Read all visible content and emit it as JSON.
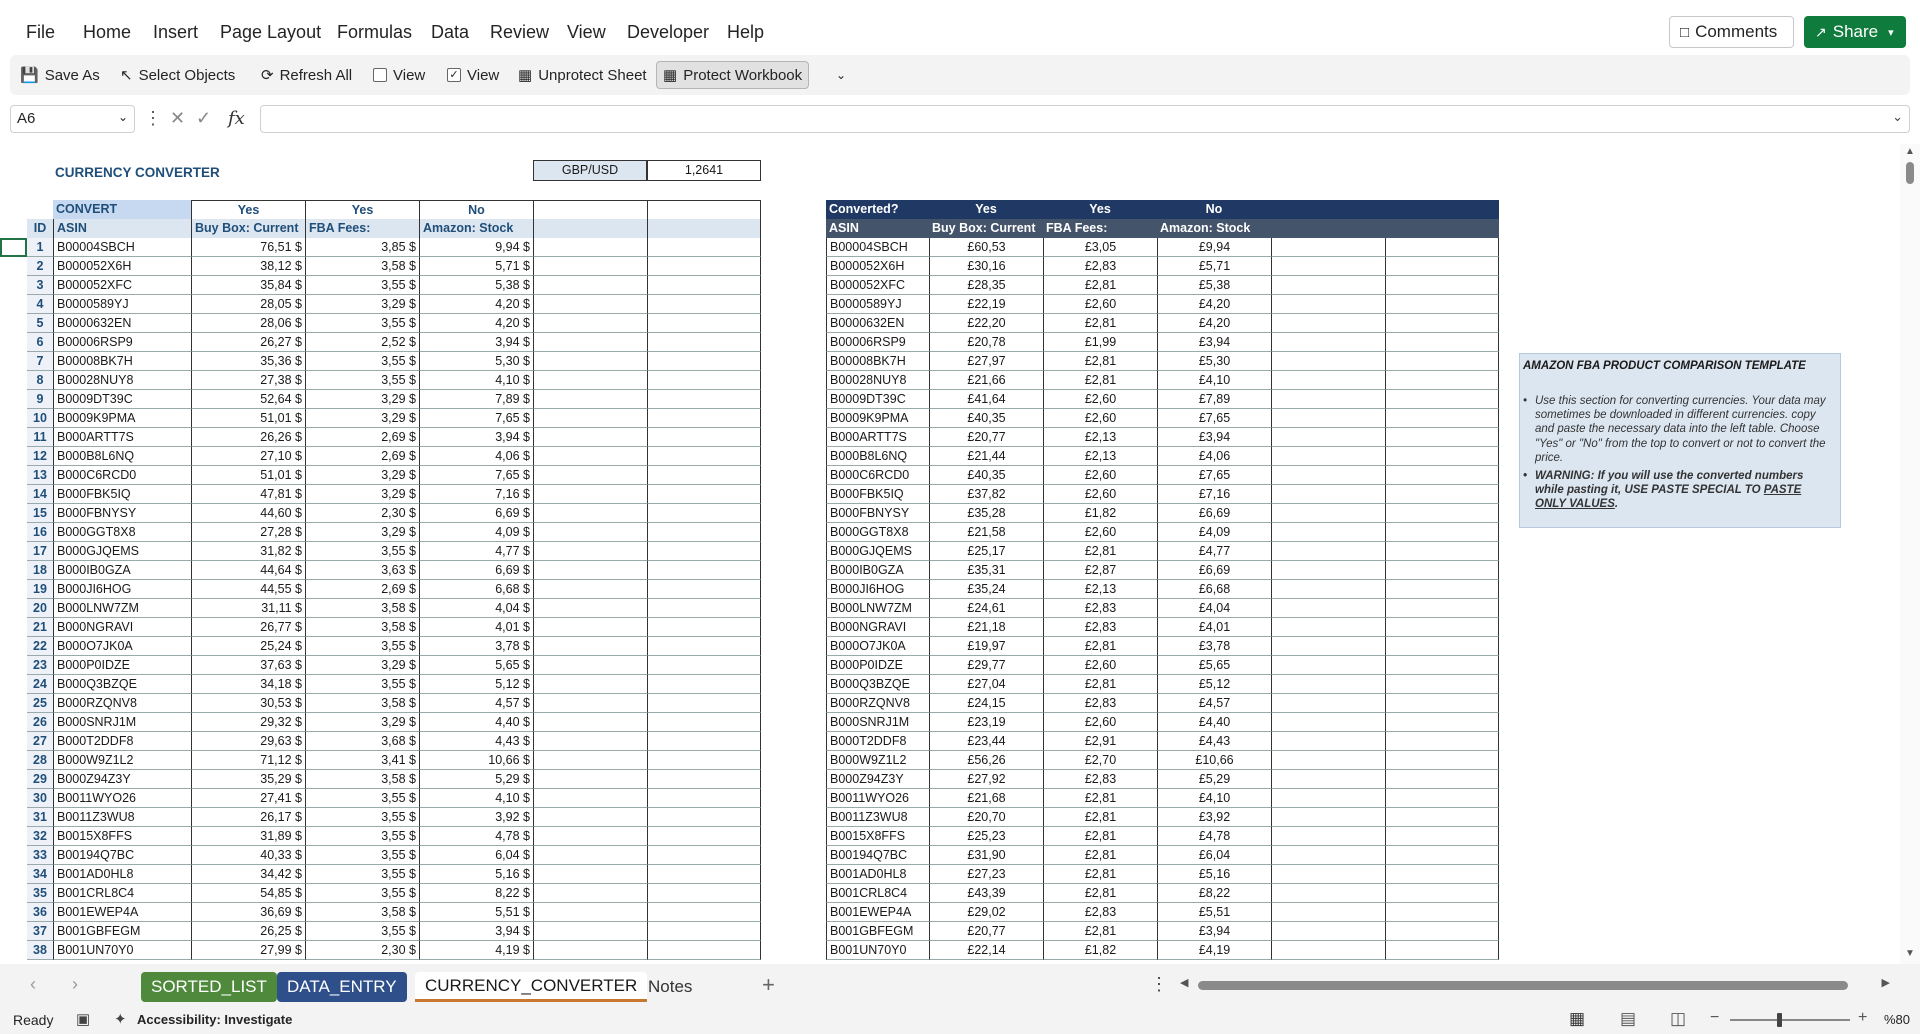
{
  "menu": {
    "items": [
      "File",
      "Home",
      "Insert",
      "Page Layout",
      "Formulas",
      "Data",
      "Review",
      "View",
      "Developer",
      "Help"
    ],
    "comments": "Comments",
    "share": "Share"
  },
  "toolbar": {
    "save_as": "Save As",
    "select_objects": "Select Objects",
    "refresh_all": "Refresh All",
    "view1": "View",
    "view1_checked": false,
    "view2": "View",
    "view2_checked": true,
    "unprotect": "Unprotect Sheet",
    "protect": "Protect Workbook"
  },
  "formula_bar": {
    "name_box": "A6",
    "fx": "fx",
    "value": ""
  },
  "sheet": {
    "title": "CURRENCY CONVERTER",
    "rate_label": "GBP/USD",
    "rate_value": "1,2641",
    "left": {
      "h1": [
        "CONVERT",
        "Yes",
        "Yes",
        "No"
      ],
      "h2": [
        "ID",
        "ASIN",
        "Buy Box: Current",
        "FBA Fees:",
        "Amazon: Stock"
      ]
    },
    "right": {
      "h1": [
        "Converted?",
        "Yes",
        "Yes",
        "No"
      ],
      "h2": [
        "ASIN",
        "Buy Box: Current",
        "FBA Fees:",
        "Amazon: Stock"
      ]
    },
    "rows": [
      [
        "1",
        "B00004SBCH",
        "76,51 $",
        "3,85 $",
        "9,94 $",
        "£60,53",
        "£3,05",
        "£9,94"
      ],
      [
        "2",
        "B000052X6H",
        "38,12 $",
        "3,58 $",
        "5,71 $",
        "£30,16",
        "£2,83",
        "£5,71"
      ],
      [
        "3",
        "B000052XFC",
        "35,84 $",
        "3,55 $",
        "5,38 $",
        "£28,35",
        "£2,81",
        "£5,38"
      ],
      [
        "4",
        "B0000589YJ",
        "28,05 $",
        "3,29 $",
        "4,20 $",
        "£22,19",
        "£2,60",
        "£4,20"
      ],
      [
        "5",
        "B0000632EN",
        "28,06 $",
        "3,55 $",
        "4,20 $",
        "£22,20",
        "£2,81",
        "£4,20"
      ],
      [
        "6",
        "B00006RSP9",
        "26,27 $",
        "2,52 $",
        "3,94 $",
        "£20,78",
        "£1,99",
        "£3,94"
      ],
      [
        "7",
        "B00008BK7H",
        "35,36 $",
        "3,55 $",
        "5,30 $",
        "£27,97",
        "£2,81",
        "£5,30"
      ],
      [
        "8",
        "B00028NUY8",
        "27,38 $",
        "3,55 $",
        "4,10 $",
        "£21,66",
        "£2,81",
        "£4,10"
      ],
      [
        "9",
        "B0009DT39C",
        "52,64 $",
        "3,29 $",
        "7,89 $",
        "£41,64",
        "£2,60",
        "£7,89"
      ],
      [
        "10",
        "B0009K9PMA",
        "51,01 $",
        "3,29 $",
        "7,65 $",
        "£40,35",
        "£2,60",
        "£7,65"
      ],
      [
        "11",
        "B000ARTT7S",
        "26,26 $",
        "2,69 $",
        "3,94 $",
        "£20,77",
        "£2,13",
        "£3,94"
      ],
      [
        "12",
        "B000B8L6NQ",
        "27,10 $",
        "2,69 $",
        "4,06 $",
        "£21,44",
        "£2,13",
        "£4,06"
      ],
      [
        "13",
        "B000C6RCD0",
        "51,01 $",
        "3,29 $",
        "7,65 $",
        "£40,35",
        "£2,60",
        "£7,65"
      ],
      [
        "14",
        "B000FBK5IQ",
        "47,81 $",
        "3,29 $",
        "7,16 $",
        "£37,82",
        "£2,60",
        "£7,16"
      ],
      [
        "15",
        "B000FBNYSY",
        "44,60 $",
        "2,30 $",
        "6,69 $",
        "£35,28",
        "£1,82",
        "£6,69"
      ],
      [
        "16",
        "B000GGT8X8",
        "27,28 $",
        "3,29 $",
        "4,09 $",
        "£21,58",
        "£2,60",
        "£4,09"
      ],
      [
        "17",
        "B000GJQEMS",
        "31,82 $",
        "3,55 $",
        "4,77 $",
        "£25,17",
        "£2,81",
        "£4,77"
      ],
      [
        "18",
        "B000IB0GZA",
        "44,64 $",
        "3,63 $",
        "6,69 $",
        "£35,31",
        "£2,87",
        "£6,69"
      ],
      [
        "19",
        "B000JI6HOG",
        "44,55 $",
        "2,69 $",
        "6,68 $",
        "£35,24",
        "£2,13",
        "£6,68"
      ],
      [
        "20",
        "B000LNW7ZM",
        "31,11 $",
        "3,58 $",
        "4,04 $",
        "£24,61",
        "£2,83",
        "£4,04"
      ],
      [
        "21",
        "B000NGRAVI",
        "26,77 $",
        "3,58 $",
        "4,01 $",
        "£21,18",
        "£2,83",
        "£4,01"
      ],
      [
        "22",
        "B000O7JK0A",
        "25,24 $",
        "3,55 $",
        "3,78 $",
        "£19,97",
        "£2,81",
        "£3,78"
      ],
      [
        "23",
        "B000P0IDZE",
        "37,63 $",
        "3,29 $",
        "5,65 $",
        "£29,77",
        "£2,60",
        "£5,65"
      ],
      [
        "24",
        "B000Q3BZQE",
        "34,18 $",
        "3,55 $",
        "5,12 $",
        "£27,04",
        "£2,81",
        "£5,12"
      ],
      [
        "25",
        "B000RZQNV8",
        "30,53 $",
        "3,58 $",
        "4,57 $",
        "£24,15",
        "£2,83",
        "£4,57"
      ],
      [
        "26",
        "B000SNRJ1M",
        "29,32 $",
        "3,29 $",
        "4,40 $",
        "£23,19",
        "£2,60",
        "£4,40"
      ],
      [
        "27",
        "B000T2DDF8",
        "29,63 $",
        "3,68 $",
        "4,43 $",
        "£23,44",
        "£2,91",
        "£4,43"
      ],
      [
        "28",
        "B000W9Z1L2",
        "71,12 $",
        "3,41 $",
        "10,66 $",
        "£56,26",
        "£2,70",
        "£10,66"
      ],
      [
        "29",
        "B000Z94Z3Y",
        "35,29 $",
        "3,58 $",
        "5,29 $",
        "£27,92",
        "£2,83",
        "£5,29"
      ],
      [
        "30",
        "B0011WYO26",
        "27,41 $",
        "3,55 $",
        "4,10 $",
        "£21,68",
        "£2,81",
        "£4,10"
      ],
      [
        "31",
        "B0011Z3WU8",
        "26,17 $",
        "3,55 $",
        "3,92 $",
        "£20,70",
        "£2,81",
        "£3,92"
      ],
      [
        "32",
        "B0015X8FFS",
        "31,89 $",
        "3,55 $",
        "4,78 $",
        "£25,23",
        "£2,81",
        "£4,78"
      ],
      [
        "33",
        "B00194Q7BC",
        "40,33 $",
        "3,55 $",
        "6,04 $",
        "£31,90",
        "£2,81",
        "£6,04"
      ],
      [
        "34",
        "B001AD0HL8",
        "34,42 $",
        "3,55 $",
        "5,16 $",
        "£27,23",
        "£2,81",
        "£5,16"
      ],
      [
        "35",
        "B001CRL8C4",
        "54,85 $",
        "3,55 $",
        "8,22 $",
        "£43,39",
        "£2,81",
        "£8,22"
      ],
      [
        "36",
        "B001EWEP4A",
        "36,69 $",
        "3,58 $",
        "5,51 $",
        "£29,02",
        "£2,83",
        "£5,51"
      ],
      [
        "37",
        "B001GBFEGM",
        "26,25 $",
        "3,55 $",
        "3,94 $",
        "£20,77",
        "£2,81",
        "£3,94"
      ],
      [
        "38",
        "B001UN70Y0",
        "27,99 $",
        "2,30 $",
        "4,19 $",
        "£22,14",
        "£1,82",
        "£4,19"
      ]
    ],
    "note": {
      "title": "AMAZON FBA PRODUCT COMPARISON TEMPLATE",
      "bullet1": "Use this section for converting currencies. Your data may sometimes be downloaded in different currencies. copy and paste the necessary data into the left table. Choose \"Yes\" or \"No\" from the top to convert or not to convert the price.",
      "bullet2_a": "WARNING: If you will use the converted numbers while pasting it, USE PASTE SPECIAL TO ",
      "bullet2_b": "PASTE ONLY VALUES",
      "bullet2_c": "."
    }
  },
  "tabs": {
    "items": [
      "SORTED_LIST",
      "DATA_ENTRY",
      "CURRENCY_CONVERTER",
      "Notes"
    ],
    "colors": {
      "sorted": "#4f8a3c",
      "data_entry": "#2e4f8a",
      "active_underline": "#c8782e"
    }
  },
  "status": {
    "ready": "Ready",
    "accessibility": "Accessibility: Investigate",
    "zoom": "%80"
  }
}
